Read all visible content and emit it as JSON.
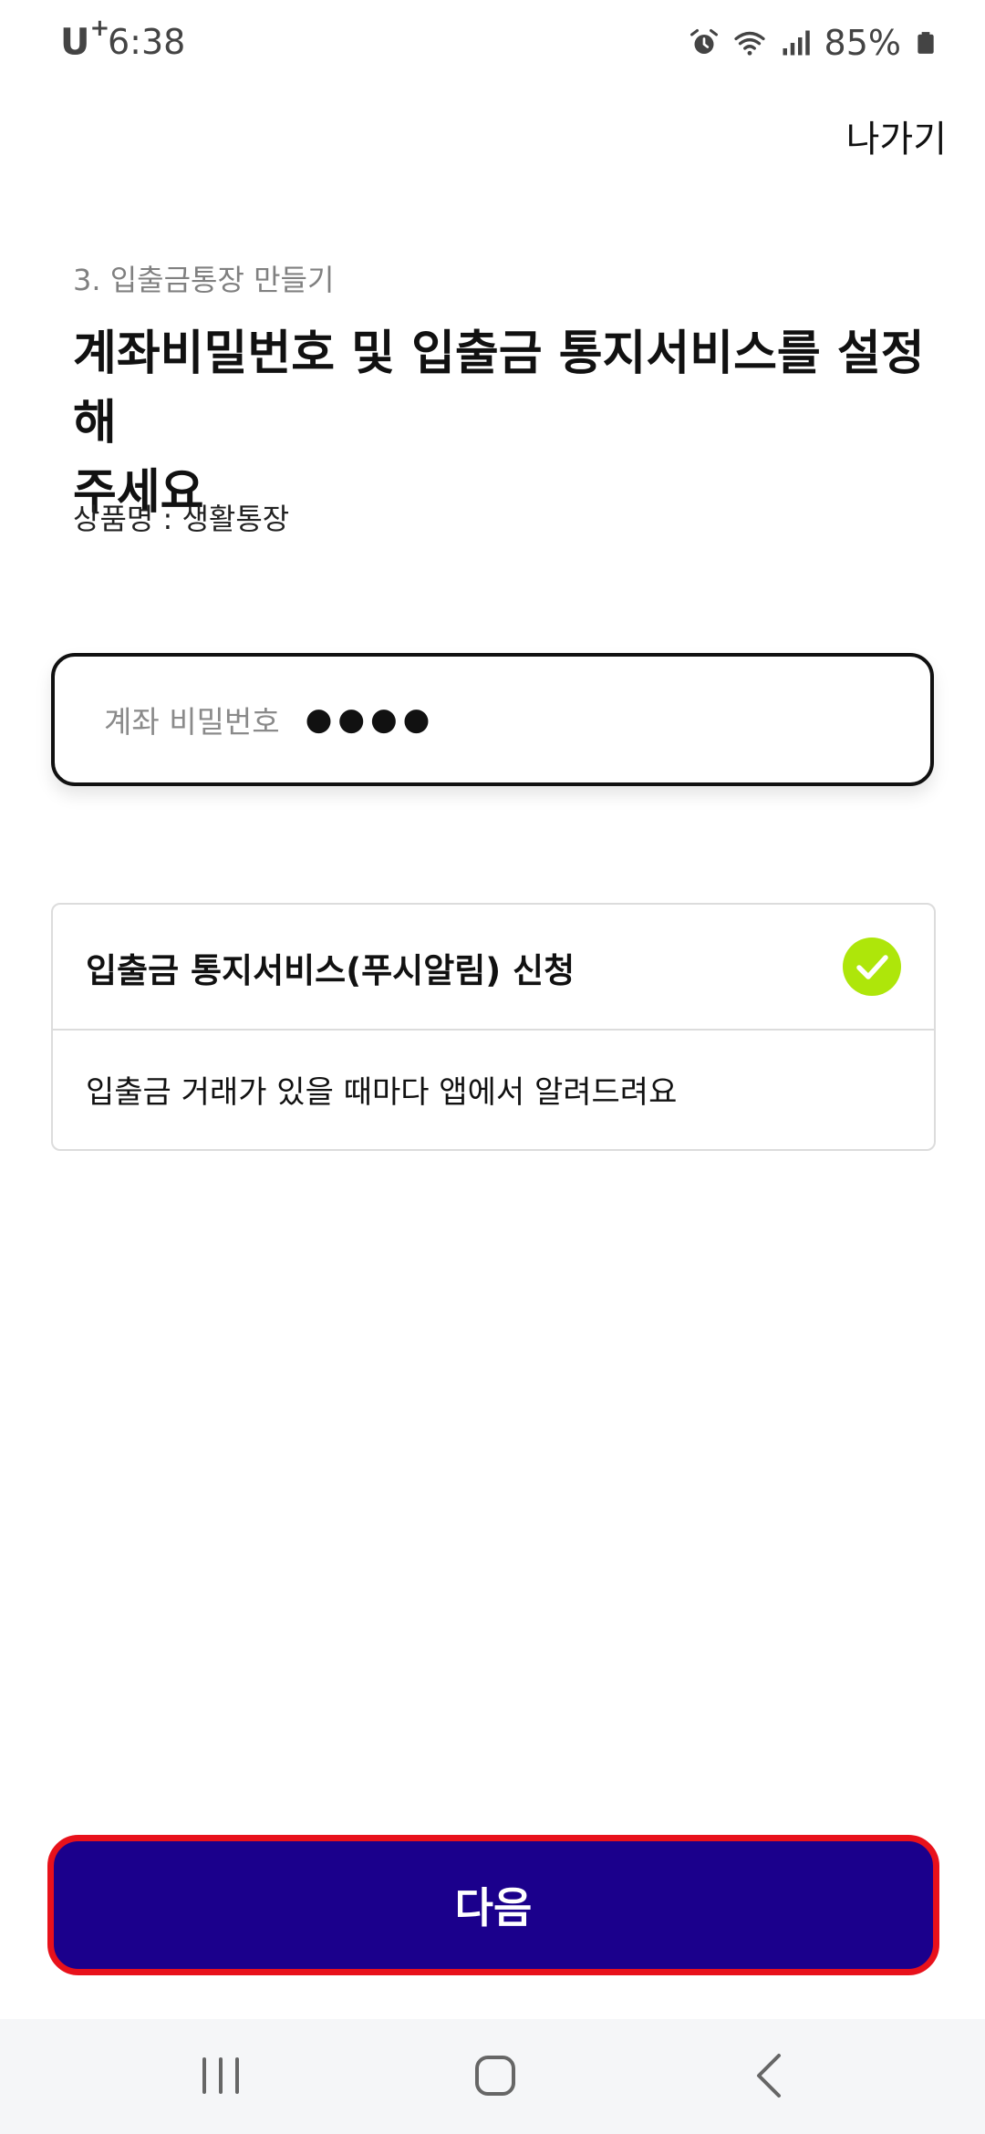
{
  "status_bar": {
    "carrier": "U",
    "carrier_plus": "+",
    "time": "6:38",
    "battery": "85%",
    "icons": [
      "alarm-icon",
      "wifi-icon",
      "signal-icon",
      "battery-icon"
    ]
  },
  "header": {
    "exit_label": "나가기"
  },
  "main": {
    "step_label": "3. 입출금통장 만들기",
    "title_line1": "계좌비밀번호 및 입출금 통지서비스를 설정해",
    "title_line2": "주세요",
    "product_name": "상품명 : 생활통장",
    "password_field": {
      "label": "계좌 비밀번호",
      "value": "●●●●"
    },
    "notice_card": {
      "title": "입출금 통지서비스(푸시알림) 신청",
      "description": "입출금 거래가 있을 때마다 앱에서 알려드려요",
      "checked": true,
      "check_color": "#aee60a"
    }
  },
  "footer": {
    "next_label": "다음",
    "next_color": "#1b008c",
    "highlight_color": "#e8111b"
  },
  "nav_bar": {
    "icons": [
      "recents-icon",
      "home-icon",
      "back-icon"
    ]
  }
}
